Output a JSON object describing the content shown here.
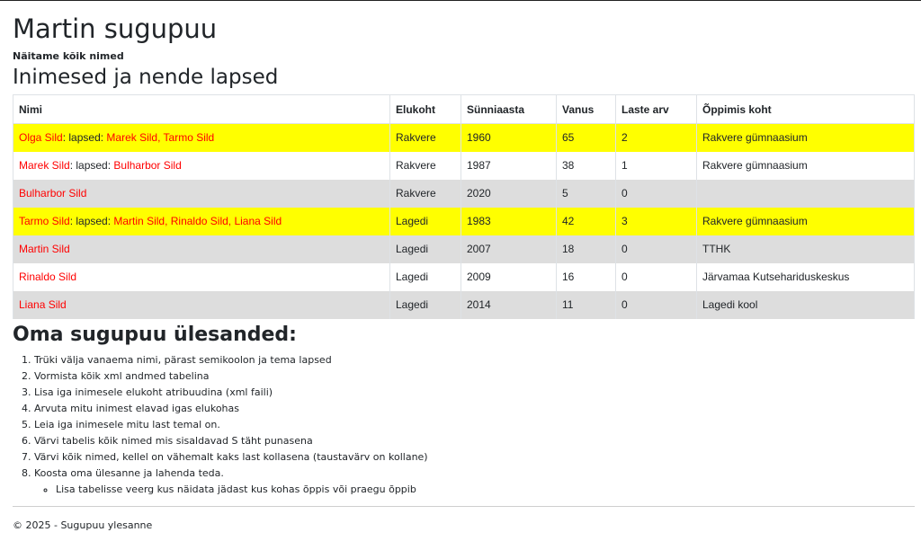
{
  "page": {
    "title": "Martin sugupuu",
    "subtitle": "Näitame kõik nimed",
    "section_title": "Inimesed ja nende lapsed"
  },
  "table": {
    "headers": [
      "Nimi",
      "Elukoht",
      "Sünniaasta",
      "Vanus",
      "Laste arv",
      "Õppimis koht"
    ],
    "rows": [
      {
        "name": "Olga Sild",
        "lapsed_prefix": "lapsed: ",
        "children": "Marek Sild, Tarmo Sild",
        "elukoht": "Rakvere",
        "synniaasta": "1960",
        "vanus": "65",
        "laste_arv": "2",
        "oppimis_koht": "Rakvere gümnaasium",
        "highlight": "yellow"
      },
      {
        "name": "Marek Sild",
        "lapsed_prefix": "lapsed: ",
        "children": "Bulharbor Sild",
        "elukoht": "Rakvere",
        "synniaasta": "1987",
        "vanus": "38",
        "laste_arv": "1",
        "oppimis_koht": "Rakvere gümnaasium",
        "highlight": "white"
      },
      {
        "name": "Bulharbor Sild",
        "lapsed_prefix": "",
        "children": "",
        "elukoht": "Rakvere",
        "synniaasta": "2020",
        "vanus": "5",
        "laste_arv": "0",
        "oppimis_koht": "",
        "highlight": "gray"
      },
      {
        "name": "Tarmo Sild",
        "lapsed_prefix": "lapsed: ",
        "children": "Martin Sild, Rinaldo Sild, Liana Sild",
        "elukoht": "Lagedi",
        "synniaasta": "1983",
        "vanus": "42",
        "laste_arv": "3",
        "oppimis_koht": "Rakvere gümnaasium",
        "highlight": "yellow"
      },
      {
        "name": "Martin Sild",
        "lapsed_prefix": "",
        "children": "",
        "elukoht": "Lagedi",
        "synniaasta": "2007",
        "vanus": "18",
        "laste_arv": "0",
        "oppimis_koht": "TTHK",
        "highlight": "gray"
      },
      {
        "name": "Rinaldo Sild",
        "lapsed_prefix": "",
        "children": "",
        "elukoht": "Lagedi",
        "synniaasta": "2009",
        "vanus": "16",
        "laste_arv": "0",
        "oppimis_koht": "Järvamaa Kutsehariduskeskus",
        "highlight": "white"
      },
      {
        "name": "Liana Sild",
        "lapsed_prefix": "",
        "children": "",
        "elukoht": "Lagedi",
        "synniaasta": "2014",
        "vanus": "11",
        "laste_arv": "0",
        "oppimis_koht": "Lagedi kool",
        "highlight": "gray"
      }
    ]
  },
  "tasks": {
    "title": "Oma sugupuu ülesanded:",
    "items": [
      "Trüki välja vanaema nimi, pärast semikoolon ja tema lapsed",
      "Vormista kõik xml andmed tabelina",
      "Lisa iga inimesele elukoht atribuudina (xml faili)",
      "Arvuta mitu inimest elavad igas elukohas",
      "Leia iga inimesele mitu last temal on.",
      "Värvi tabelis kõik nimed mis sisaldavad S täht punasena",
      "Värvi kõik nimed, kellel on vähemalt kaks last kollasena (taustavärv on kollane)",
      "Koosta oma ülesanne ja lahenda teda."
    ],
    "subitem": "Lisa tabelisse veerg kus näidata jädast kus kohas õppis või praegu õppib"
  },
  "footer": {
    "text": "© 2025 - Sugupuu ylesanne"
  },
  "colors": {
    "highlight_yellow": "#ffff00",
    "row_gray": "#dddddd",
    "name_red": "#ff0000"
  }
}
